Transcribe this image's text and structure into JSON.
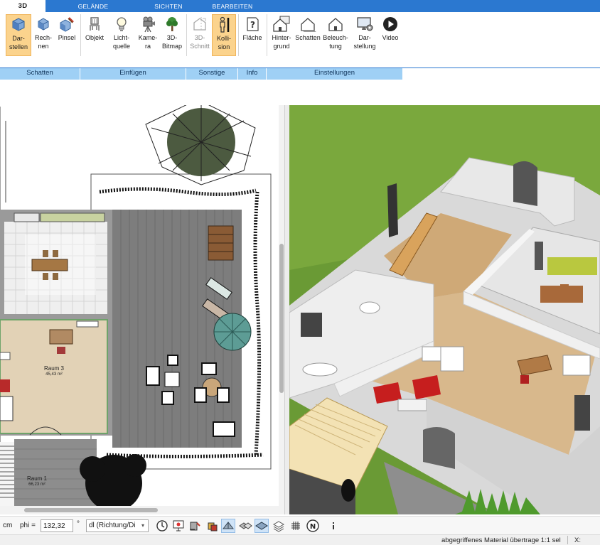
{
  "ribbon": {
    "tabs": [
      {
        "label": "3D",
        "active": true
      },
      {
        "label": "GELÄNDE",
        "active": false
      },
      {
        "label": "SICHTEN",
        "active": false
      },
      {
        "label": "BEARBEITEN",
        "active": false
      }
    ],
    "buttons": [
      {
        "label": "Dar-\nstellen",
        "icon": "cube-display-icon",
        "active": true
      },
      {
        "label": "Rech-\nnen",
        "icon": "cube-compute-icon",
        "active": false
      },
      {
        "label": "Pinsel",
        "icon": "cube-brush-icon",
        "active": false
      },
      {
        "label": "Objekt",
        "icon": "chair-icon",
        "active": false
      },
      {
        "label": "Licht-\nquelle",
        "icon": "light-bulb-icon",
        "active": false
      },
      {
        "label": "Kame-\nra",
        "icon": "camera-icon",
        "active": false
      },
      {
        "label": "3D-\nBitmap",
        "icon": "tree-icon",
        "active": false
      },
      {
        "label": "3D-\nSchnitt",
        "icon": "section-cut-icon",
        "active": false,
        "disabled": true
      },
      {
        "label": "Kolli-\nsion",
        "icon": "person-collision-icon",
        "active": true
      },
      {
        "label": "Fläche",
        "icon": "area-info-icon",
        "active": false
      },
      {
        "label": "Hinter-\ngrund",
        "icon": "house-background-icon",
        "active": false
      },
      {
        "label": "Schatten",
        "icon": "house-shadow-icon",
        "active": false
      },
      {
        "label": "Beleuch-\ntung",
        "icon": "house-lighting-icon",
        "active": false
      },
      {
        "label": "Dar-\nstellung",
        "icon": "monitor-display-icon",
        "active": false
      },
      {
        "label": "Video",
        "icon": "play-video-icon",
        "active": false
      }
    ],
    "groups": [
      "Schatten",
      "Einfügen",
      "Sonstige",
      "Info",
      "Einstellungen"
    ]
  },
  "plan": {
    "rooms": [
      {
        "name": "Raum 3",
        "area": "45,43 m²"
      },
      {
        "name": "Raum 1",
        "area": "66,23 m²"
      }
    ]
  },
  "bottom": {
    "unit": "cm",
    "phi_label": "phi =",
    "phi_value": "132,32",
    "degree": "°",
    "direction_select": "dl (Richtung/Di",
    "caret": "▾",
    "tools": [
      {
        "icon": "clock-icon",
        "active": false
      },
      {
        "icon": "presentation-icon",
        "active": false
      },
      {
        "icon": "paint-bucket-icon",
        "active": false
      },
      {
        "icon": "material-pick-icon",
        "active": true
      },
      {
        "icon": "material-transfer-icon",
        "active": false
      },
      {
        "icon": "layer-diamond-icon",
        "active": true
      },
      {
        "icon": "layers-icon",
        "active": false
      },
      {
        "icon": "grid-icon",
        "active": false
      },
      {
        "icon": "north-icon",
        "active": false
      },
      {
        "icon": "more-options-icon",
        "active": false
      }
    ],
    "north_label": "N"
  },
  "status": {
    "message": "abgegriffenes Material übertrage 1:1 sel",
    "coord_label": "X:"
  },
  "colors": {
    "ribbon_blue": "#2b78d0",
    "group_blue": "#9fd0f5",
    "active_orange": "#fbd38d"
  }
}
